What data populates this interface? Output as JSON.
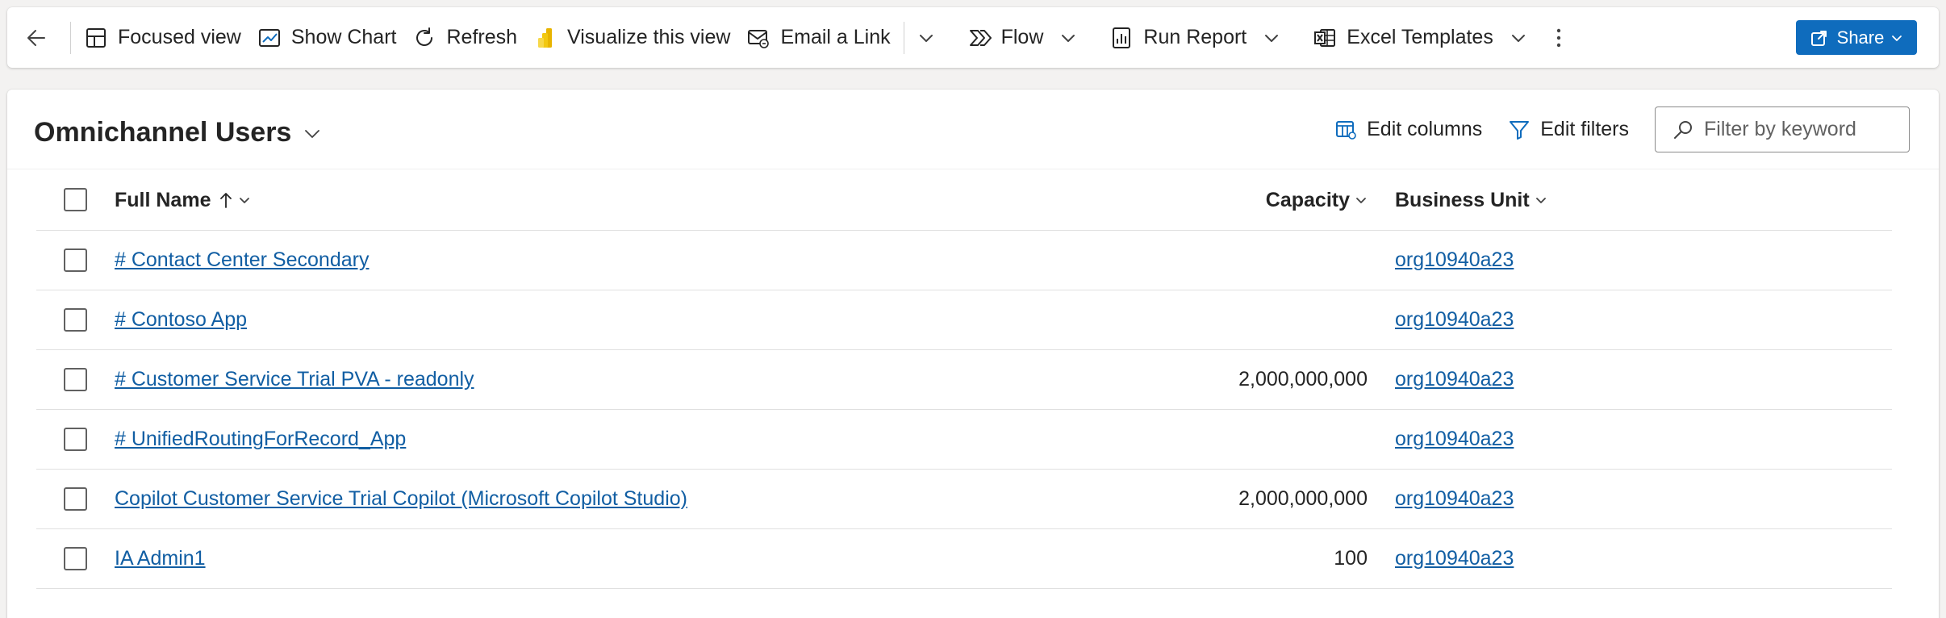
{
  "commandbar": {
    "items": {
      "focused_view": "Focused view",
      "show_chart": "Show Chart",
      "refresh": "Refresh",
      "visualize": "Visualize this view",
      "email_link": "Email a Link",
      "flow": "Flow",
      "run_report": "Run Report",
      "excel_templates": "Excel Templates"
    },
    "share": "Share"
  },
  "view": {
    "title": "Omnichannel Users",
    "edit_columns": "Edit columns",
    "edit_filters": "Edit filters",
    "filter_placeholder": "Filter by keyword"
  },
  "grid": {
    "headers": {
      "full_name": "Full Name",
      "capacity": "Capacity",
      "business_unit": "Business Unit"
    },
    "rows": [
      {
        "name": "# Contact Center Secondary",
        "capacity": "",
        "business_unit": "org10940a23"
      },
      {
        "name": "# Contoso App",
        "capacity": "",
        "business_unit": "org10940a23"
      },
      {
        "name": "# Customer Service Trial PVA - readonly",
        "capacity": "2,000,000,000",
        "business_unit": "org10940a23"
      },
      {
        "name": "# UnifiedRoutingForRecord_App",
        "capacity": "",
        "business_unit": "org10940a23"
      },
      {
        "name": "Copilot Customer Service Trial Copilot (Microsoft Copilot Studio)",
        "capacity": "2,000,000,000",
        "business_unit": "org10940a23"
      },
      {
        "name": "IA Admin1",
        "capacity": "100",
        "business_unit": "org10940a23"
      }
    ]
  },
  "colors": {
    "accent": "#0f6cbd",
    "link": "#115ea3",
    "text": "#242424",
    "background": "#f3f2f1"
  },
  "icons": {
    "back": "arrow-left-icon",
    "focused_view": "layout-icon",
    "show_chart": "chart-icon",
    "refresh": "refresh-icon",
    "visualize": "power-bi-icon",
    "email_link": "email-link-icon",
    "flow": "flow-icon",
    "run_report": "report-icon",
    "excel_templates": "excel-icon",
    "more": "more-vertical-icon",
    "share": "share-icon",
    "edit_columns": "columns-icon",
    "edit_filters": "filter-icon",
    "search": "search-icon"
  }
}
